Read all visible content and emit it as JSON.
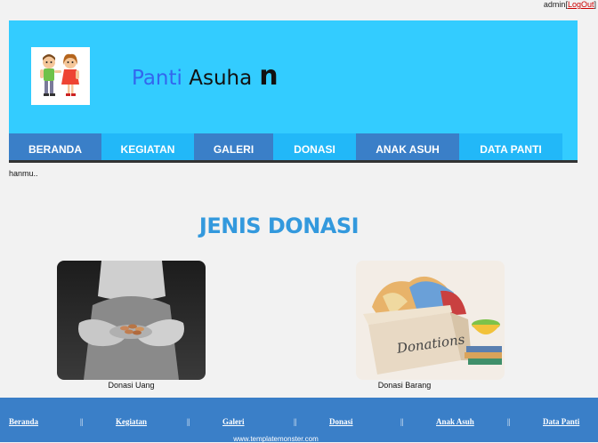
{
  "topbar": {
    "user": "admin",
    "bracket_open": "[",
    "logout": "LogOut",
    "bracket_close": "]"
  },
  "header": {
    "title_part1": "Panti",
    "title_part2": "Asuha",
    "title_part3": "n"
  },
  "nav": {
    "items": [
      {
        "label": "BERANDA"
      },
      {
        "label": "KEGIATAN"
      },
      {
        "label": "GALERI"
      },
      {
        "label": "DONASI"
      },
      {
        "label": "ANAK ASUH"
      },
      {
        "label": "DATA PANTI"
      }
    ]
  },
  "marquee": "hanmu..",
  "main": {
    "heading": "JENIS DONASI",
    "cards": [
      {
        "caption": "Donasi Uang"
      },
      {
        "caption": "Donasi Barang",
        "box_text": "Donations"
      }
    ]
  },
  "footer": {
    "links": [
      "Beranda",
      "Kegiatan",
      "Galeri",
      "Donasi",
      "Anak Asuh",
      "Data Panti"
    ],
    "separator": "||",
    "credit": "www.templatemonster.com"
  },
  "colors": {
    "header": "#33ccff",
    "nav_dark": "#3a7fc8",
    "nav_light": "#22b8f8",
    "heading": "#3399dd",
    "footer": "#3a7fc8"
  }
}
